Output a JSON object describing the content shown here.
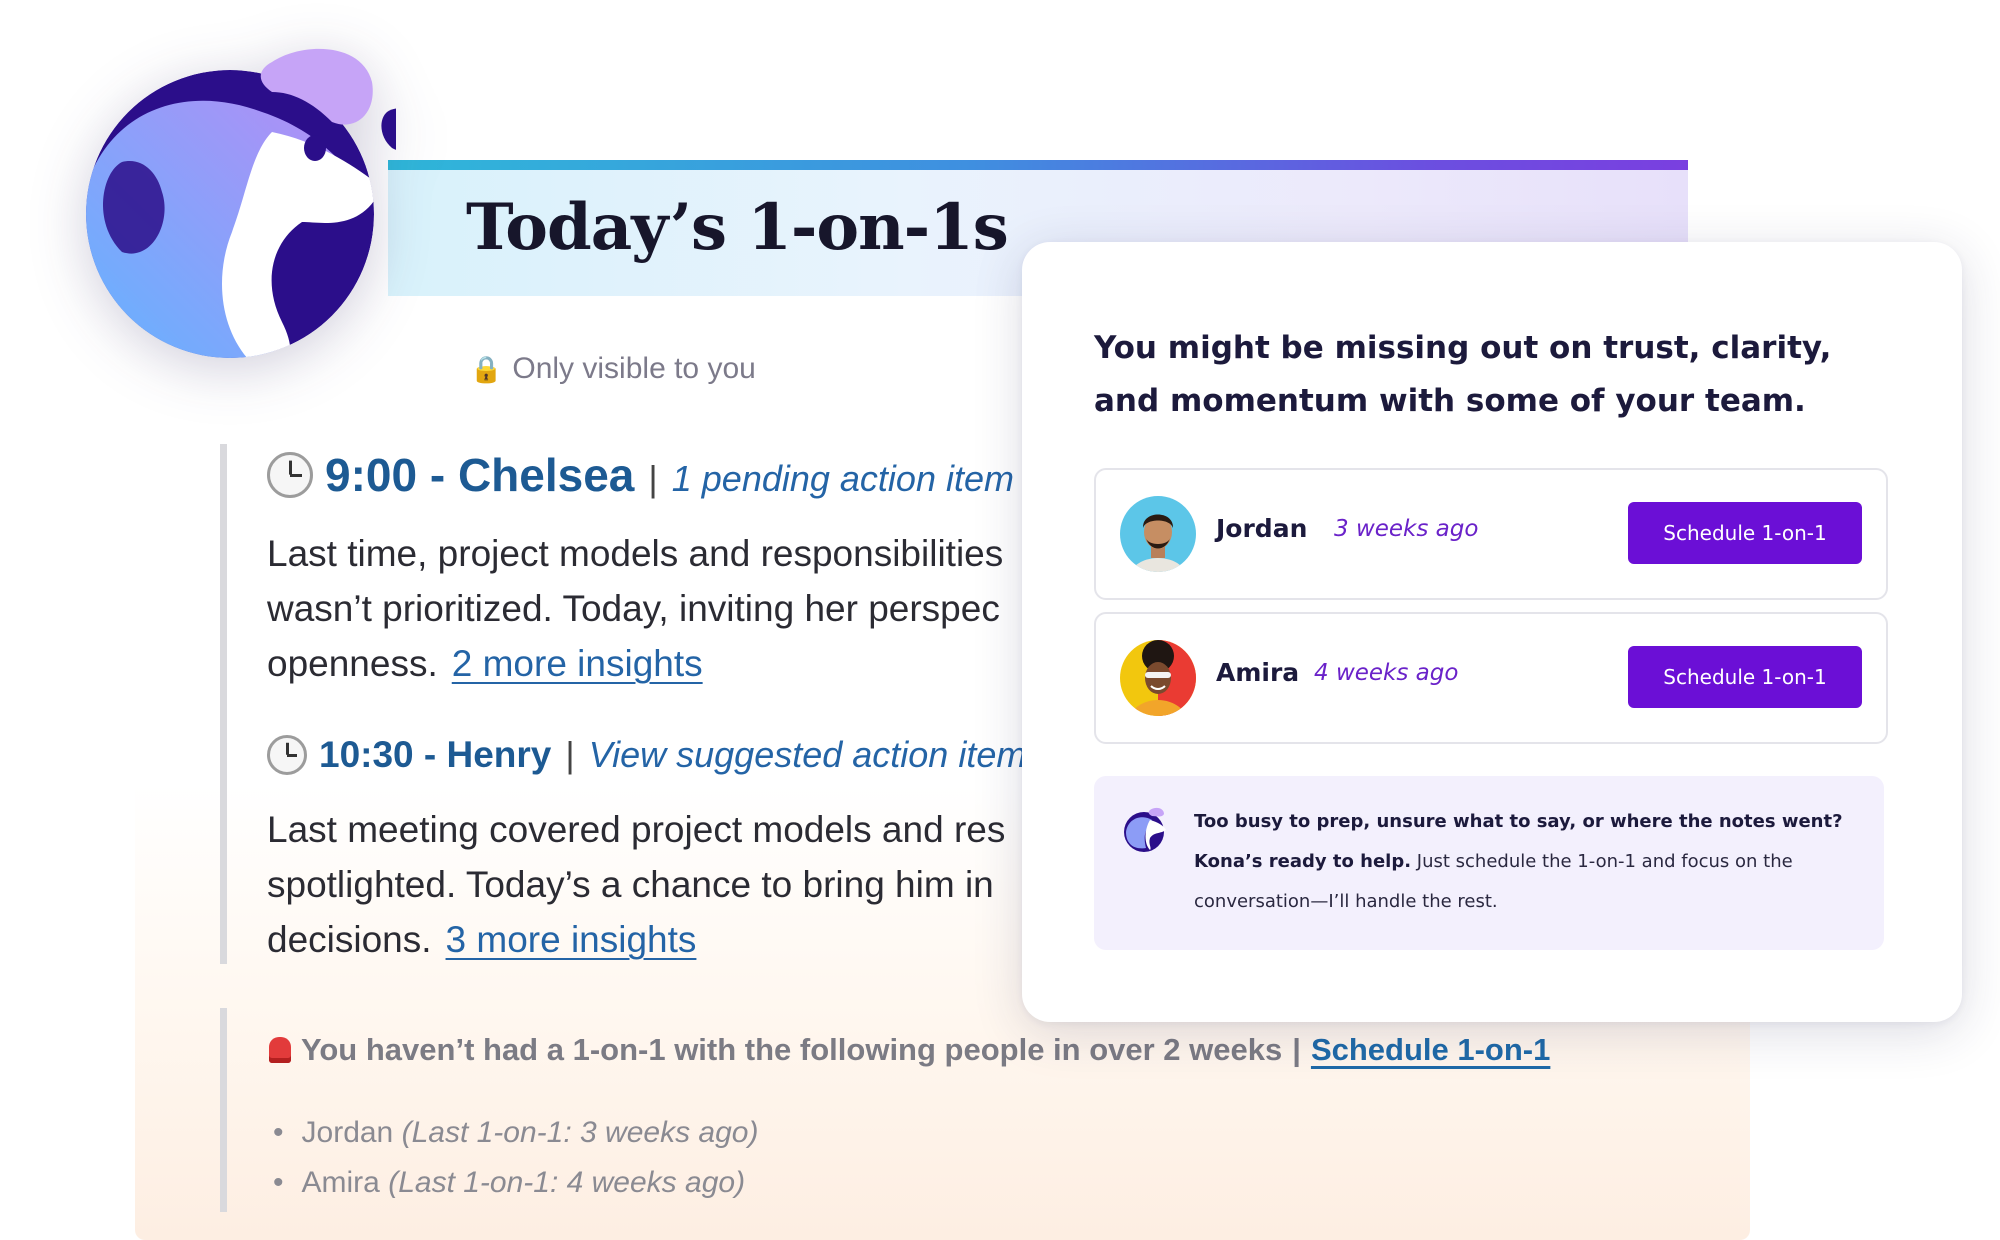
{
  "banner": {
    "title": "Today’s 1-on-1s"
  },
  "visibility_note": "Only visible to you",
  "meetings": [
    {
      "time_name": "9:00 - Chelsea",
      "separator": "|",
      "action_label": "1 pending action item",
      "lines": [
        "Last time, project models and responsibilities",
        "wasn’t prioritized. Today, inviting her perspec"
      ],
      "last_line": "openness.",
      "insights_link": "2 more insights"
    },
    {
      "time_name": "10:30 - Henry",
      "separator": "|",
      "action_label": "View suggested action item",
      "lines": [
        "Last meeting covered project models and res",
        "spotlighted. Today’s a chance to bring him in"
      ],
      "last_line": "decisions.",
      "insights_link": "3 more insights"
    }
  ],
  "overdue": {
    "heading": "You haven’t had a 1-on-1 with the following people in over 2 weeks",
    "separator": "|",
    "schedule_link": "Schedule 1-on-1",
    "people": [
      {
        "name": "Jordan",
        "last": "(Last 1-on-1: 3 weeks ago)"
      },
      {
        "name": "Amira",
        "last": "(Last 1-on-1: 4 weeks ago)"
      }
    ]
  },
  "panel": {
    "title": "You might be missing out on trust, clarity, and momentum with some of your team.",
    "people": [
      {
        "name": "Jordan",
        "ago": "3 weeks ago",
        "button": "Schedule 1-on-1"
      },
      {
        "name": "Amira",
        "ago": "4 weeks ago",
        "button": "Schedule 1-on-1"
      }
    ],
    "tip_bold": "Too busy to prep, unsure what to say, or where the notes went? Kona’s ready to help.",
    "tip_rest": "Just schedule the 1-on-1 and focus on the conversation—I’ll handle the rest."
  },
  "colors": {
    "accent_purple": "#6b0fd6",
    "link_blue": "#2464a6",
    "heading_blue": "#1d5a93"
  },
  "icons": [
    "dog-mascot-icon",
    "lock-icon",
    "clock-icon",
    "siren-icon",
    "kona-icon"
  ]
}
